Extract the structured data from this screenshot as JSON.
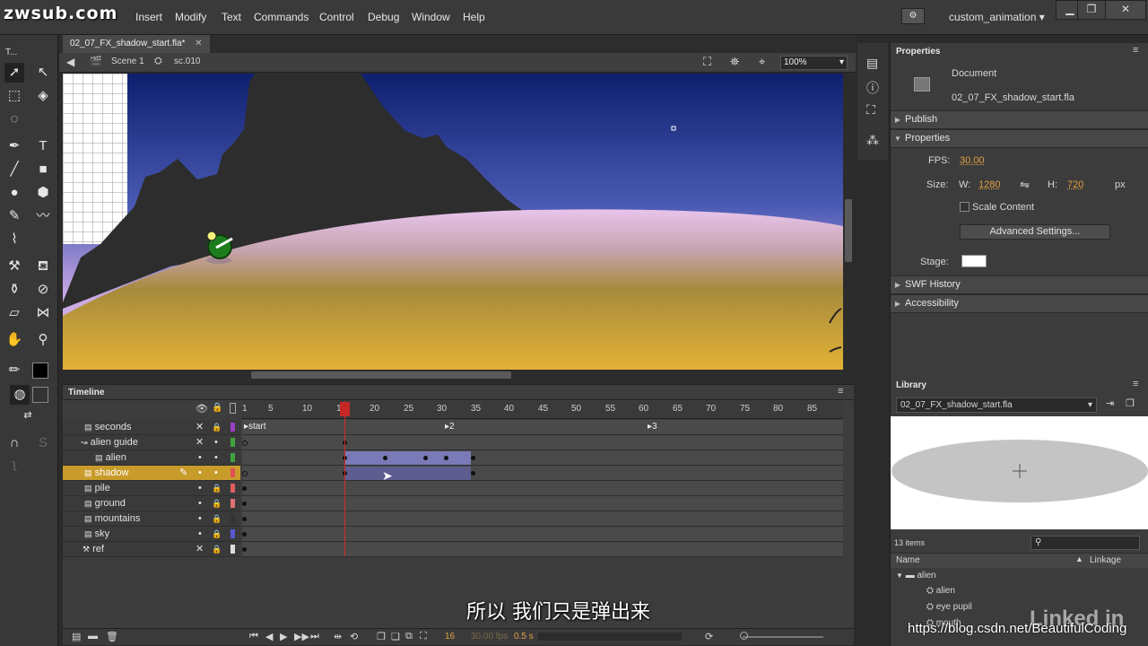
{
  "watermark": "zwsub.com",
  "menu": [
    "Insert",
    "Modify",
    "Text",
    "Commands",
    "Control",
    "Debug",
    "Window",
    "Help"
  ],
  "workspace": "custom_animation",
  "tools_header": "T...",
  "document_tab": "02_07_FX_shadow_start.fla*",
  "edit_bar": {
    "scene": "Scene 1",
    "symbol": "sc.010",
    "zoom": "100%"
  },
  "properties": {
    "panel_title": "Properties",
    "doc_type": "Document",
    "doc_name": "02_07_FX_shadow_start.fla",
    "sections": {
      "publish": "Publish",
      "properties": "Properties",
      "swf_history": "SWF History",
      "accessibility": "Accessibility"
    },
    "fps_label": "FPS:",
    "fps": "30.00",
    "size_label": "Size:",
    "w_label": "W:",
    "width": "1280",
    "h_label": "H:",
    "height": "720",
    "unit": "px",
    "scale_content": "Scale Content",
    "advanced_settings": "Advanced Settings...",
    "stage_label": "Stage:",
    "stage_color": "#ffffff"
  },
  "timeline": {
    "title": "Timeline",
    "frame_numbers": [
      "1",
      "5",
      "10",
      "15",
      "20",
      "25",
      "30",
      "35",
      "40",
      "45",
      "50",
      "55",
      "60",
      "65",
      "70",
      "75",
      "80",
      "85"
    ],
    "markers": {
      "start": "start",
      "m2": "2",
      "m3": "3"
    },
    "layers": [
      {
        "name": "seconds",
        "color": "#9b40c4"
      },
      {
        "name": "alien guide",
        "color": "#3fa33f"
      },
      {
        "name": "alien",
        "color": "#3fa33f"
      },
      {
        "name": "shadow",
        "color": "#e05050"
      },
      {
        "name": "pile",
        "color": "#e06060"
      },
      {
        "name": "ground",
        "color": "#e07070"
      },
      {
        "name": "mountains",
        "color": "#333333"
      },
      {
        "name": "sky",
        "color": "#5a5ad0"
      },
      {
        "name": "ref",
        "color": "#dddddd"
      }
    ],
    "status": {
      "frame": "16",
      "fps": "30.00 fps",
      "time": "0.5 s"
    }
  },
  "library": {
    "title": "Library",
    "document": "02_07_FX_shadow_start.fla",
    "item_count": "13 items",
    "col_name": "Name",
    "col_linkage": "Linkage",
    "items": [
      "alien",
      "alien",
      "eye pupil",
      "mouth"
    ]
  },
  "subtitle": "所以  我们只是弹出来",
  "source_watermark": "https://blog.csdn.net/BeautifulCoding",
  "brand_watermark": "Linked in"
}
